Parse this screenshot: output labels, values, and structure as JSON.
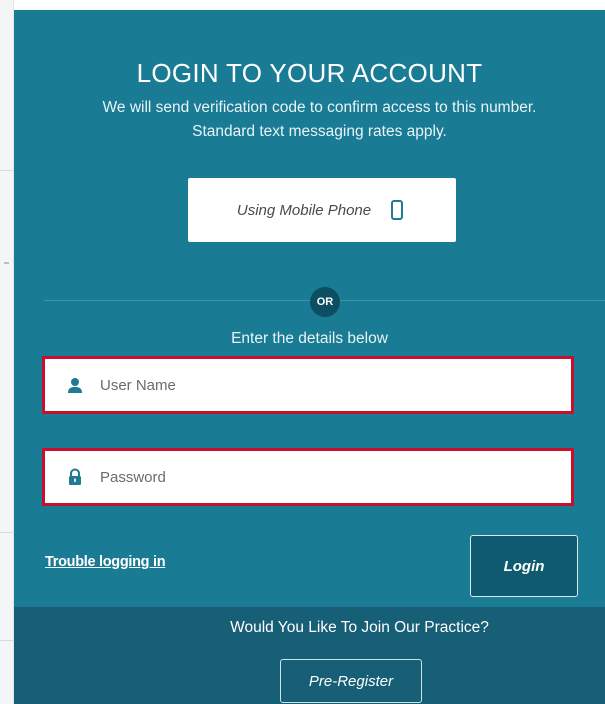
{
  "login_panel": {
    "title": "LOGIN TO YOUR ACCOUNT",
    "subtitle_line1": "We will send verification code to confirm access to this number.",
    "subtitle_line2": "Standard text messaging rates apply.",
    "mobile_button": {
      "label": "Using Mobile Phone",
      "icon": "mobile-phone-icon"
    },
    "or_label": "OR",
    "enter_details": "Enter the details below",
    "username_field": {
      "placeholder": "User Name",
      "value": "",
      "icon": "user-icon"
    },
    "password_field": {
      "placeholder": "Password",
      "value": "",
      "icon": "lock-icon"
    },
    "trouble_link": "Trouble logging in",
    "login_button": "Login"
  },
  "footer": {
    "join_text": "Would You Like To Join Our Practice?",
    "preregister_button": "Pre-Register"
  },
  "colors": {
    "panel_bg": "#1a7b94",
    "footer_bg": "#175f76",
    "field_border_highlight": "#c8102e",
    "or_badge": "#0d4f62",
    "login_button_bg": "#0f5a70",
    "icon_teal": "#1f7a92"
  }
}
